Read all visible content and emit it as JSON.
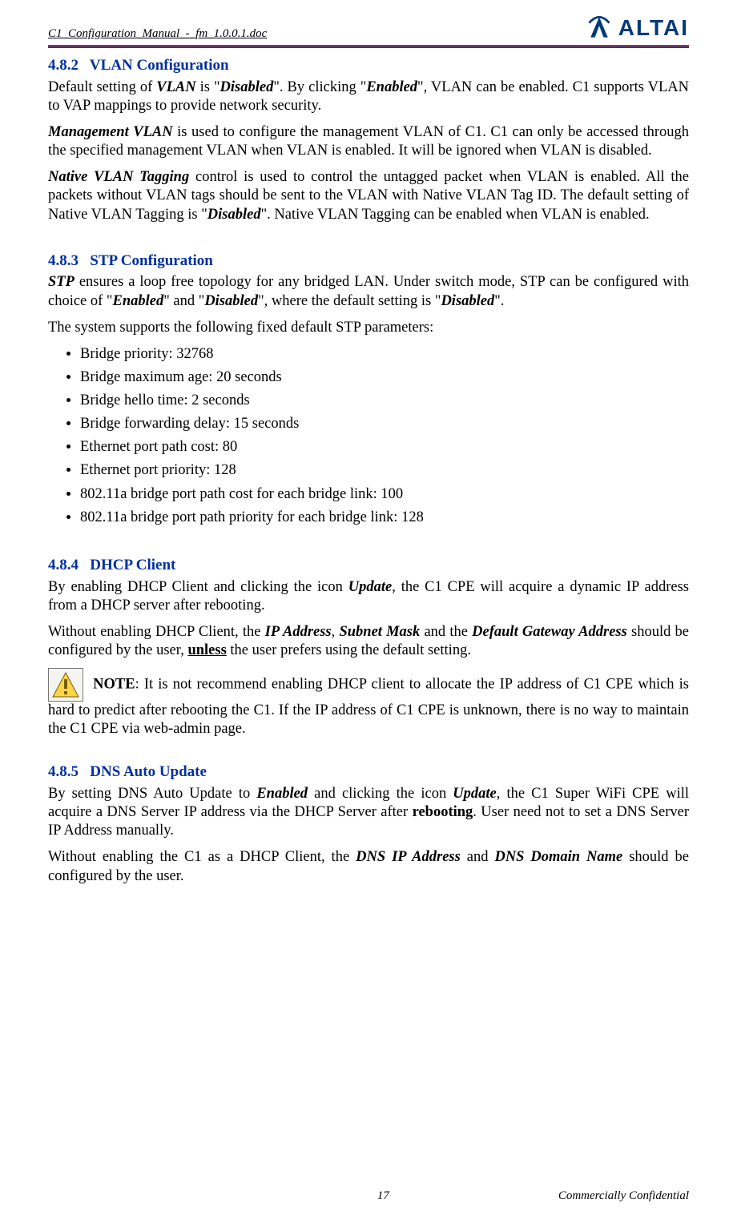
{
  "header": {
    "doc_title": "C1_Configuration_Manual_-_fm_1.0.0.1.doc",
    "brand": "ALTAI"
  },
  "sections": {
    "s482": {
      "num": "4.8.2",
      "title": "VLAN Configuration",
      "p1_a": "Default setting of ",
      "p1_b": "VLAN",
      "p1_c": " is \"",
      "p1_d": "Disabled",
      "p1_e": "\". By clicking \"",
      "p1_f": "Enabled",
      "p1_g": "\", VLAN can be enabled. C1 supports VLAN to VAP mappings to provide network security.",
      "p2_a": "Management VLAN",
      "p2_b": " is used to configure the management VLAN of C1. C1 can only be accessed through the specified management VLAN when VLAN is enabled. It will be ignored when VLAN is disabled.",
      "p3_a": "Native VLAN Tagging",
      "p3_b": " control is used to control the untagged packet when VLAN is enabled. All the packets without VLAN tags should be sent to the VLAN with Native VLAN Tag ID. The default setting of Native VLAN Tagging is \"",
      "p3_c": "Disabled",
      "p3_d": "\". Native VLAN Tagging can be enabled when VLAN is enabled."
    },
    "s483": {
      "num": "4.8.3",
      "title": "STP Configuration",
      "p1_a": "STP",
      "p1_b": " ensures a loop free topology for any bridged LAN. Under switch mode, STP can be configured with choice of \"",
      "p1_c": "Enabled",
      "p1_d": "\" and \"",
      "p1_e": "Disabled",
      "p1_f": "\", where the default setting is \"",
      "p1_g": "Disabled",
      "p1_h": "\".",
      "p2": "The system supports the following fixed default STP parameters:",
      "bullets": [
        "Bridge priority: 32768",
        "Bridge maximum age: 20 seconds",
        "Bridge hello time: 2 seconds",
        "Bridge forwarding delay: 15 seconds",
        "Ethernet port path cost: 80",
        "Ethernet port priority: 128",
        "802.11a bridge port path cost for each bridge link: 100",
        "802.11a bridge port path priority for each bridge link: 128"
      ]
    },
    "s484": {
      "num": "4.8.4",
      "title": "DHCP Client",
      "p1_a": "By enabling DHCP Client and clicking the icon ",
      "p1_b": "Update",
      "p1_c": ", the C1 CPE will acquire a dynamic IP address from a DHCP server after rebooting.",
      "p2_a": "Without enabling DHCP Client, the ",
      "p2_b": "IP Address",
      "p2_c": ", ",
      "p2_d": "Subnet Mask",
      "p2_e": " and the ",
      "p2_f": "Default Gateway Address",
      "p2_g": " should be configured by the user, ",
      "p2_h": "unless",
      "p2_i": " the user prefers using the default setting.",
      "note_a": "NOTE",
      "note_b": ": It is not recommend enabling DHCP client to allocate the IP address of C1 CPE which is hard to predict after rebooting the C1. If the IP address of C1 CPE is unknown, there is no way to maintain the C1 CPE via web-admin page."
    },
    "s485": {
      "num": "4.8.5",
      "title": "DNS Auto Update",
      "p1_a": "By setting DNS Auto Update to ",
      "p1_b": "Enabled",
      "p1_c": " and clicking the icon ",
      "p1_d": "Update",
      "p1_e": ", the C1 Super WiFi CPE will acquire a DNS Server IP address via the DHCP Server after ",
      "p1_f": "rebooting",
      "p1_g": ". User need not to set a DNS Server IP Address manually.",
      "p2_a": "Without enabling the C1 as a DHCP Client, the ",
      "p2_b": "DNS IP Address",
      "p2_c": " and ",
      "p2_d": "DNS Domain Name",
      "p2_e": " should be configured by the user."
    }
  },
  "footer": {
    "page": "17",
    "confidential": "Commercially Confidential"
  }
}
